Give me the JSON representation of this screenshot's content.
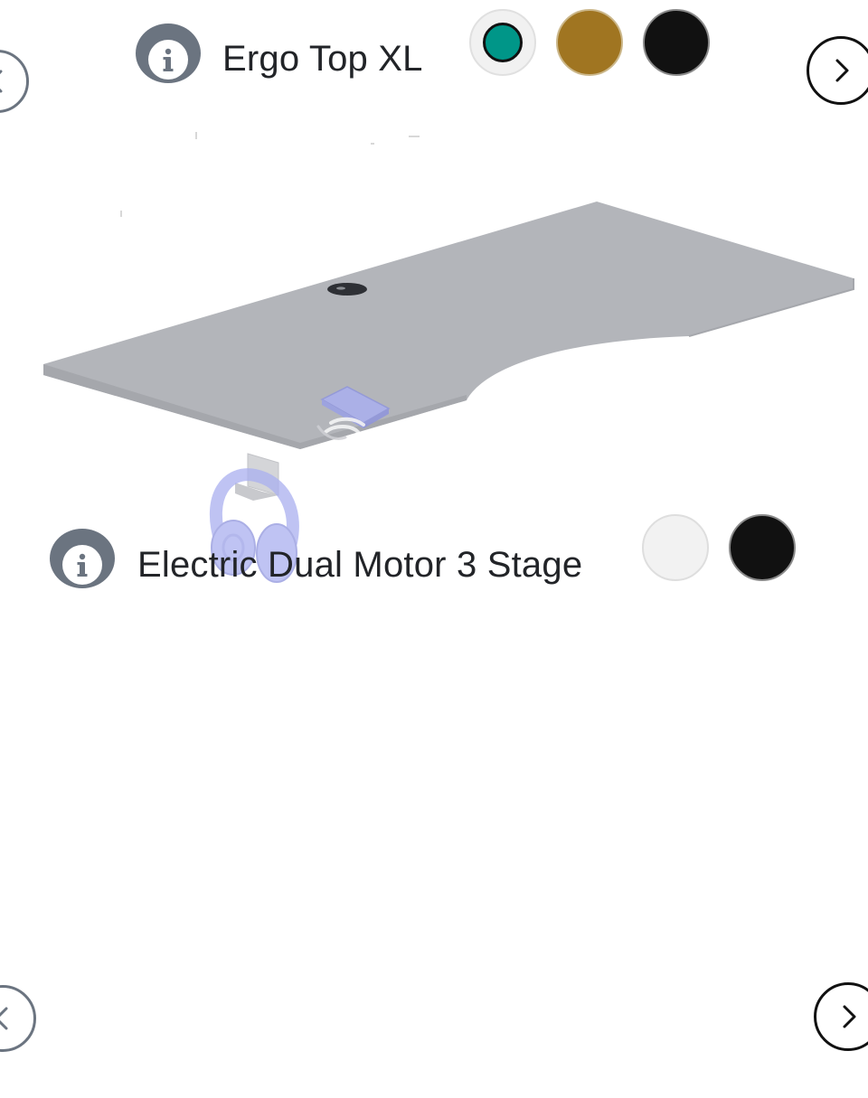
{
  "components": [
    {
      "title": "Ergo Top XL",
      "info_icon": "info-icon",
      "swatches": [
        {
          "color": "#009688",
          "selected": true
        },
        {
          "color": "#a07521",
          "selected": false
        },
        {
          "color": "#111111",
          "selected": false
        }
      ]
    },
    {
      "title": "Electric Dual Motor 3 Stage",
      "info_icon": "info-icon",
      "swatches": [
        {
          "color": "#f2f2f2",
          "selected": false
        },
        {
          "color": "#111111",
          "selected": false
        }
      ]
    }
  ],
  "navigation": {
    "prev_icon": "chevron-left-icon",
    "next_icon": "chevron-right-icon"
  },
  "colors": {
    "desktop_surface": "#b3b5ba",
    "accessory_tint": "#aab0f0",
    "icon_gray": "#6b7480"
  }
}
